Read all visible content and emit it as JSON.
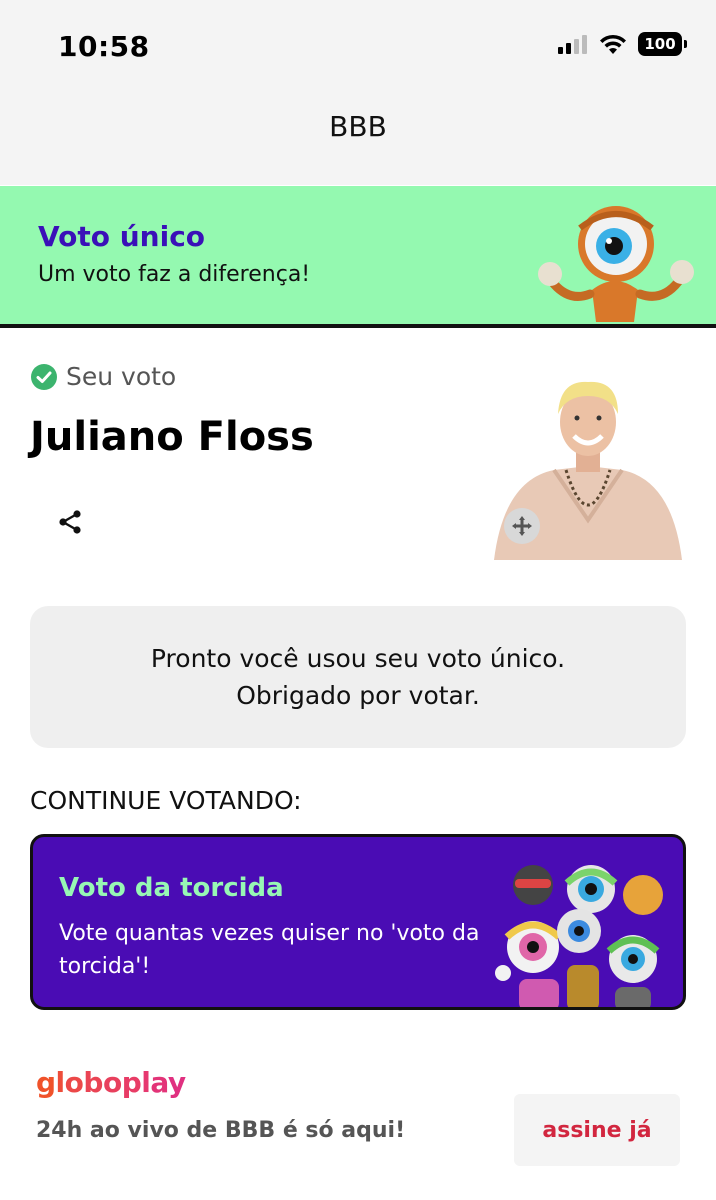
{
  "status_bar": {
    "time": "10:58",
    "battery": "100"
  },
  "header": {
    "title": "BBB"
  },
  "banner": {
    "title": "Voto único",
    "subtitle": "Um voto faz a diferença!"
  },
  "vote": {
    "label": "Seu voto",
    "candidate": "Juliano Floss"
  },
  "message": {
    "line1": "Pronto você usou seu voto único.",
    "line2": "Obrigado por votar."
  },
  "continue_label": "CONTINUE VOTANDO:",
  "card": {
    "title": "Voto da torcida",
    "description": "Vote quantas vezes quiser no 'voto da torcida'!"
  },
  "footer": {
    "logo": "globoplay",
    "text": "24h ao vivo de BBB é só aqui!",
    "button": "assine já"
  },
  "colors": {
    "banner_bg": "#94f9b0",
    "banner_title": "#3a10b8",
    "card_bg": "#4a0cb4",
    "card_title": "#97f7b4",
    "check": "#3cb46e",
    "subscribe": "#d2263f"
  },
  "icons": [
    "signal-icon",
    "wifi-icon",
    "battery-icon",
    "check-circle-icon",
    "share-icon",
    "move-icon"
  ]
}
